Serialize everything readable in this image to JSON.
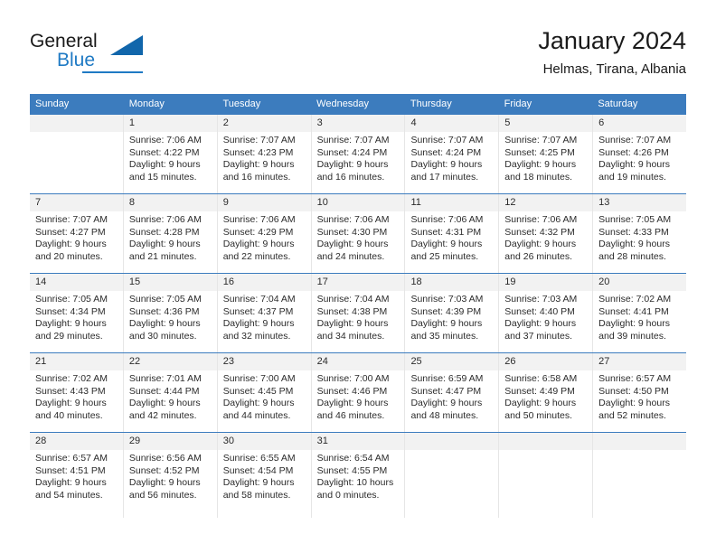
{
  "brand": {
    "name_part1": "General",
    "name_part2": "Blue",
    "logo_icon": "triangle-icon"
  },
  "header": {
    "title": "January 2024",
    "subtitle": "Helmas, Tirana, Albania"
  },
  "calendar": {
    "weekday_headers": [
      "Sunday",
      "Monday",
      "Tuesday",
      "Wednesday",
      "Thursday",
      "Friday",
      "Saturday"
    ],
    "accent_color": "#3c7cbe",
    "daynum_band_color": "#f2f2f2",
    "weeks": [
      [
        {
          "day": "",
          "lines": []
        },
        {
          "day": "1",
          "lines": [
            "Sunrise: 7:06 AM",
            "Sunset: 4:22 PM",
            "Daylight: 9 hours",
            "and 15 minutes."
          ]
        },
        {
          "day": "2",
          "lines": [
            "Sunrise: 7:07 AM",
            "Sunset: 4:23 PM",
            "Daylight: 9 hours",
            "and 16 minutes."
          ]
        },
        {
          "day": "3",
          "lines": [
            "Sunrise: 7:07 AM",
            "Sunset: 4:24 PM",
            "Daylight: 9 hours",
            "and 16 minutes."
          ]
        },
        {
          "day": "4",
          "lines": [
            "Sunrise: 7:07 AM",
            "Sunset: 4:24 PM",
            "Daylight: 9 hours",
            "and 17 minutes."
          ]
        },
        {
          "day": "5",
          "lines": [
            "Sunrise: 7:07 AM",
            "Sunset: 4:25 PM",
            "Daylight: 9 hours",
            "and 18 minutes."
          ]
        },
        {
          "day": "6",
          "lines": [
            "Sunrise: 7:07 AM",
            "Sunset: 4:26 PM",
            "Daylight: 9 hours",
            "and 19 minutes."
          ]
        }
      ],
      [
        {
          "day": "7",
          "lines": [
            "Sunrise: 7:07 AM",
            "Sunset: 4:27 PM",
            "Daylight: 9 hours",
            "and 20 minutes."
          ]
        },
        {
          "day": "8",
          "lines": [
            "Sunrise: 7:06 AM",
            "Sunset: 4:28 PM",
            "Daylight: 9 hours",
            "and 21 minutes."
          ]
        },
        {
          "day": "9",
          "lines": [
            "Sunrise: 7:06 AM",
            "Sunset: 4:29 PM",
            "Daylight: 9 hours",
            "and 22 minutes."
          ]
        },
        {
          "day": "10",
          "lines": [
            "Sunrise: 7:06 AM",
            "Sunset: 4:30 PM",
            "Daylight: 9 hours",
            "and 24 minutes."
          ]
        },
        {
          "day": "11",
          "lines": [
            "Sunrise: 7:06 AM",
            "Sunset: 4:31 PM",
            "Daylight: 9 hours",
            "and 25 minutes."
          ]
        },
        {
          "day": "12",
          "lines": [
            "Sunrise: 7:06 AM",
            "Sunset: 4:32 PM",
            "Daylight: 9 hours",
            "and 26 minutes."
          ]
        },
        {
          "day": "13",
          "lines": [
            "Sunrise: 7:05 AM",
            "Sunset: 4:33 PM",
            "Daylight: 9 hours",
            "and 28 minutes."
          ]
        }
      ],
      [
        {
          "day": "14",
          "lines": [
            "Sunrise: 7:05 AM",
            "Sunset: 4:34 PM",
            "Daylight: 9 hours",
            "and 29 minutes."
          ]
        },
        {
          "day": "15",
          "lines": [
            "Sunrise: 7:05 AM",
            "Sunset: 4:36 PM",
            "Daylight: 9 hours",
            "and 30 minutes."
          ]
        },
        {
          "day": "16",
          "lines": [
            "Sunrise: 7:04 AM",
            "Sunset: 4:37 PM",
            "Daylight: 9 hours",
            "and 32 minutes."
          ]
        },
        {
          "day": "17",
          "lines": [
            "Sunrise: 7:04 AM",
            "Sunset: 4:38 PM",
            "Daylight: 9 hours",
            "and 34 minutes."
          ]
        },
        {
          "day": "18",
          "lines": [
            "Sunrise: 7:03 AM",
            "Sunset: 4:39 PM",
            "Daylight: 9 hours",
            "and 35 minutes."
          ]
        },
        {
          "day": "19",
          "lines": [
            "Sunrise: 7:03 AM",
            "Sunset: 4:40 PM",
            "Daylight: 9 hours",
            "and 37 minutes."
          ]
        },
        {
          "day": "20",
          "lines": [
            "Sunrise: 7:02 AM",
            "Sunset: 4:41 PM",
            "Daylight: 9 hours",
            "and 39 minutes."
          ]
        }
      ],
      [
        {
          "day": "21",
          "lines": [
            "Sunrise: 7:02 AM",
            "Sunset: 4:43 PM",
            "Daylight: 9 hours",
            "and 40 minutes."
          ]
        },
        {
          "day": "22",
          "lines": [
            "Sunrise: 7:01 AM",
            "Sunset: 4:44 PM",
            "Daylight: 9 hours",
            "and 42 minutes."
          ]
        },
        {
          "day": "23",
          "lines": [
            "Sunrise: 7:00 AM",
            "Sunset: 4:45 PM",
            "Daylight: 9 hours",
            "and 44 minutes."
          ]
        },
        {
          "day": "24",
          "lines": [
            "Sunrise: 7:00 AM",
            "Sunset: 4:46 PM",
            "Daylight: 9 hours",
            "and 46 minutes."
          ]
        },
        {
          "day": "25",
          "lines": [
            "Sunrise: 6:59 AM",
            "Sunset: 4:47 PM",
            "Daylight: 9 hours",
            "and 48 minutes."
          ]
        },
        {
          "day": "26",
          "lines": [
            "Sunrise: 6:58 AM",
            "Sunset: 4:49 PM",
            "Daylight: 9 hours",
            "and 50 minutes."
          ]
        },
        {
          "day": "27",
          "lines": [
            "Sunrise: 6:57 AM",
            "Sunset: 4:50 PM",
            "Daylight: 9 hours",
            "and 52 minutes."
          ]
        }
      ],
      [
        {
          "day": "28",
          "lines": [
            "Sunrise: 6:57 AM",
            "Sunset: 4:51 PM",
            "Daylight: 9 hours",
            "and 54 minutes."
          ]
        },
        {
          "day": "29",
          "lines": [
            "Sunrise: 6:56 AM",
            "Sunset: 4:52 PM",
            "Daylight: 9 hours",
            "and 56 minutes."
          ]
        },
        {
          "day": "30",
          "lines": [
            "Sunrise: 6:55 AM",
            "Sunset: 4:54 PM",
            "Daylight: 9 hours",
            "and 58 minutes."
          ]
        },
        {
          "day": "31",
          "lines": [
            "Sunrise: 6:54 AM",
            "Sunset: 4:55 PM",
            "Daylight: 10 hours",
            "and 0 minutes."
          ]
        },
        {
          "day": "",
          "lines": []
        },
        {
          "day": "",
          "lines": []
        },
        {
          "day": "",
          "lines": []
        }
      ]
    ]
  }
}
